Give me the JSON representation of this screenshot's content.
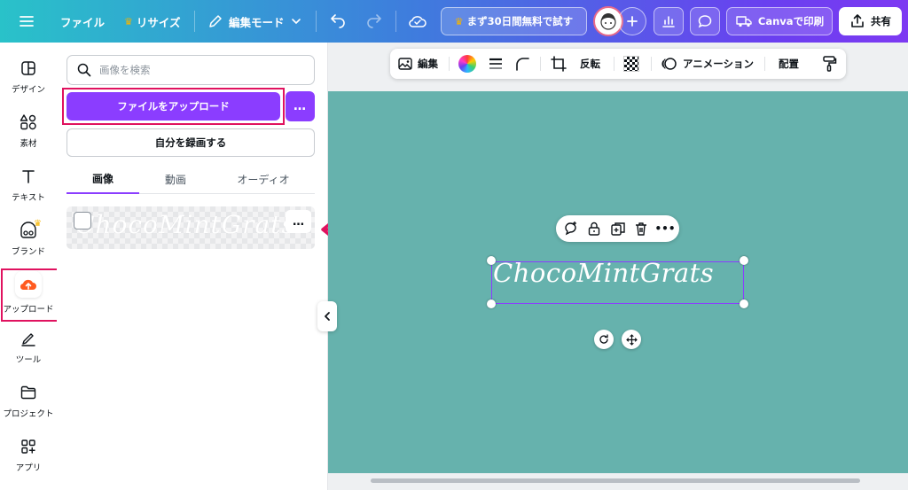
{
  "topbar": {
    "menu_icon": "hamburger-icon",
    "file_label": "ファイル",
    "resize_label": "リサイズ",
    "edit_mode_label": "編集モード",
    "trial_label": "まず30日間無料で試す",
    "print_label": "Canvaで印刷",
    "share_label": "共有"
  },
  "rail": {
    "items": [
      {
        "label": "デザイン",
        "icon": "layout-icon"
      },
      {
        "label": "素材",
        "icon": "shapes-icon"
      },
      {
        "label": "テキスト",
        "icon": "text-icon"
      },
      {
        "label": "ブランド",
        "icon": "brand-icon"
      },
      {
        "label": "アップロード",
        "icon": "upload-cloud-icon"
      },
      {
        "label": "ツール",
        "icon": "draw-icon"
      },
      {
        "label": "プロジェクト",
        "icon": "folder-icon"
      },
      {
        "label": "アプリ",
        "icon": "apps-icon"
      }
    ],
    "active_index": 4
  },
  "panel": {
    "search_placeholder": "画像を検索",
    "upload_button": "ファイルをアップロード",
    "more_button": "…",
    "record_button": "自分を録画する",
    "tabs": [
      {
        "label": "画像",
        "active": true
      },
      {
        "label": "動画",
        "active": false
      },
      {
        "label": "オーディオ",
        "active": false
      }
    ],
    "asset_text": "ChocoMintGrats",
    "asset_more": "…"
  },
  "context_toolbar": {
    "edit_label": "編集",
    "flip_label": "反転",
    "animation_label": "アニメーション",
    "position_label": "配置"
  },
  "canvas": {
    "element_text": "ChocoMintGrats",
    "background_color": "#66b2ad"
  },
  "colors": {
    "accent": "#8b3dff",
    "highlight": "#e0125f"
  }
}
